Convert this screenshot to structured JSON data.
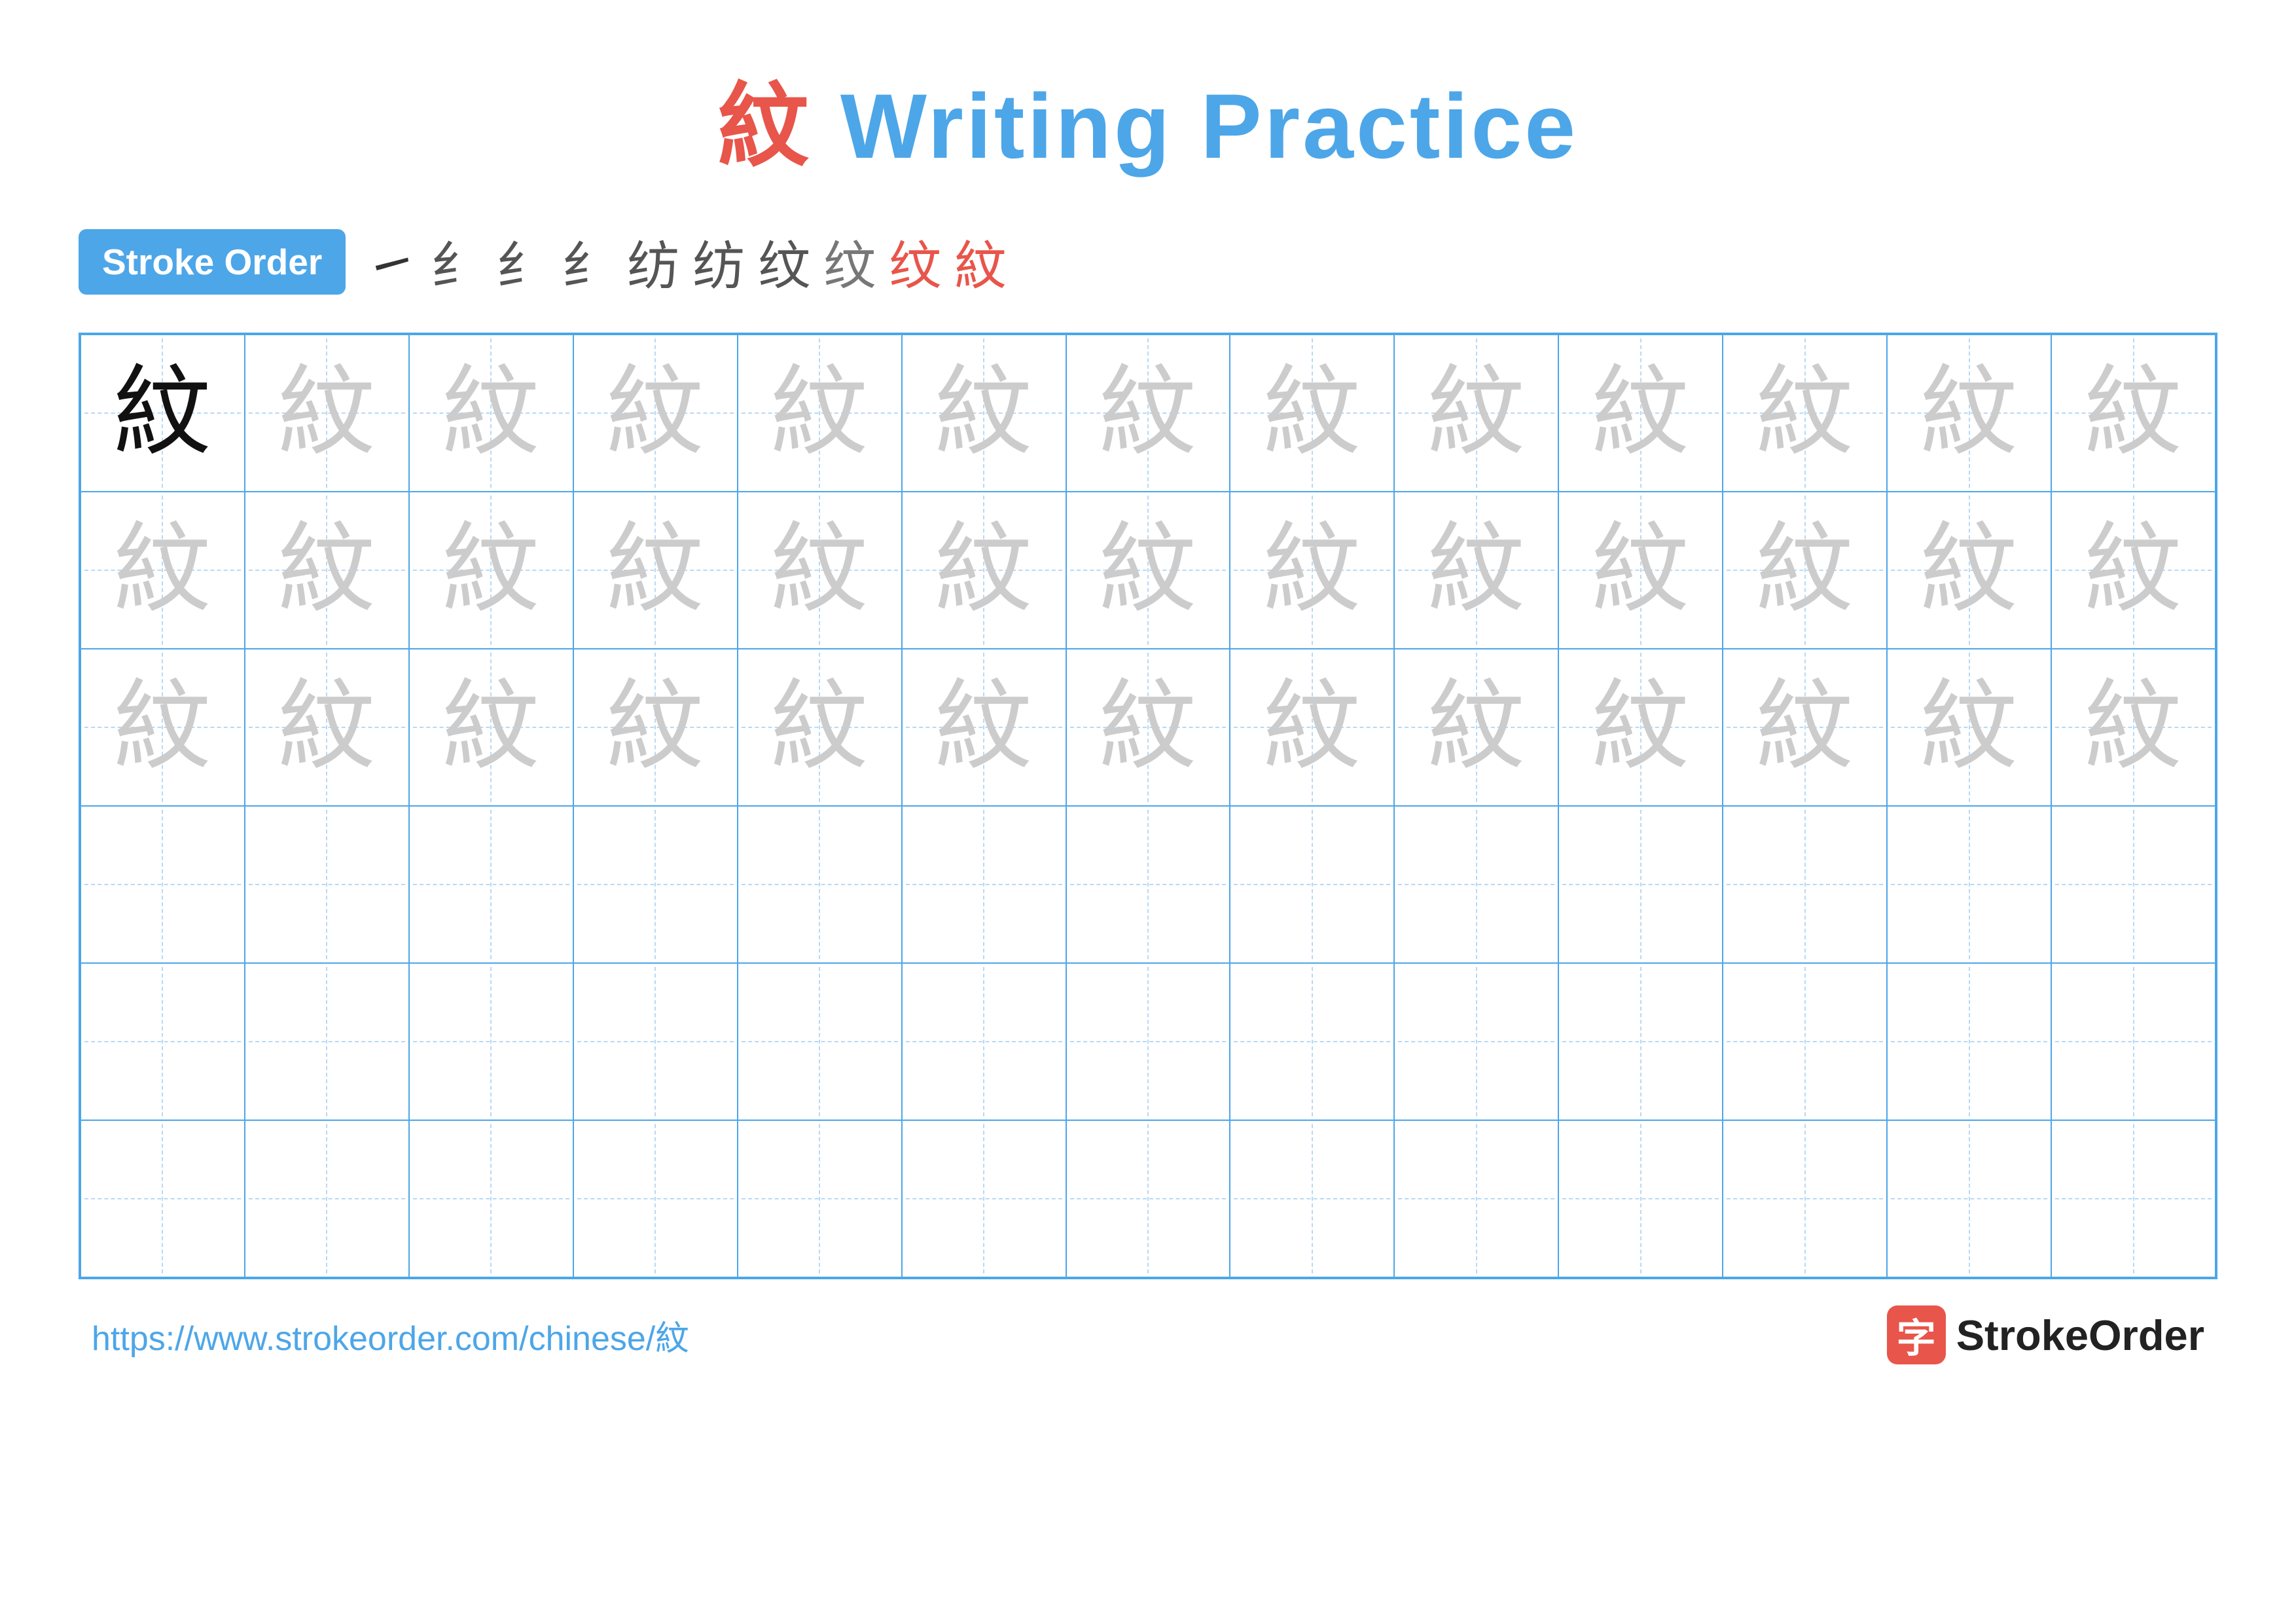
{
  "title": {
    "chinese": "紋",
    "text": " Writing Practice",
    "color_chinese": "#e8554a",
    "color_text": "#4da6e8"
  },
  "stroke_order": {
    "badge_label": "Stroke Order",
    "steps": [
      "㇀",
      "纟",
      "纟",
      "纟",
      "纟",
      "纟",
      "纺",
      "纹",
      "纹",
      "紋"
    ]
  },
  "grid": {
    "rows": 6,
    "cols": 13,
    "character": "紋",
    "row_1_type": "dark_then_light",
    "row_2_type": "light",
    "row_3_type": "light",
    "row_4_type": "empty",
    "row_5_type": "empty",
    "row_6_type": "empty"
  },
  "footer": {
    "url": "https://www.strokeorder.com/chinese/紋",
    "logo_char": "字",
    "logo_name": "StrokeOrder"
  }
}
